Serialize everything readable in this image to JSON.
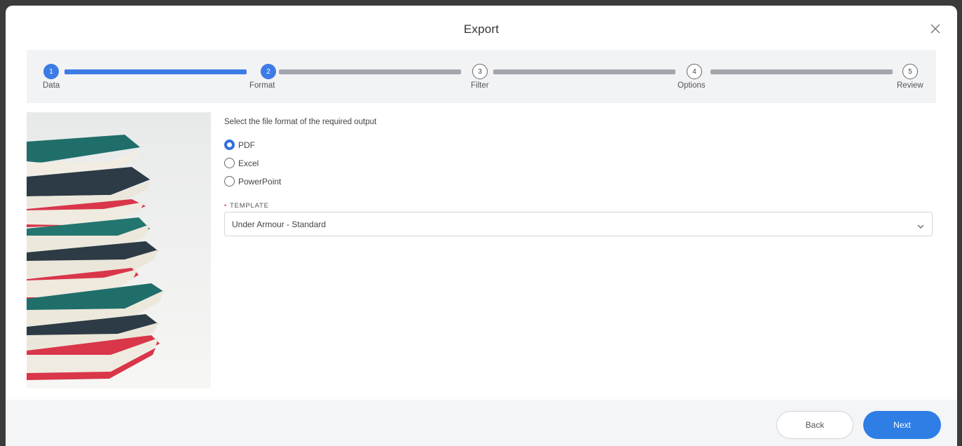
{
  "dialog": {
    "title": "Export",
    "close_icon": "close-icon"
  },
  "stepper": {
    "steps": [
      {
        "number": "1",
        "label": "Data",
        "state": "complete"
      },
      {
        "number": "2",
        "label": "Format",
        "state": "current"
      },
      {
        "number": "3",
        "label": "Filter",
        "state": "pending"
      },
      {
        "number": "4",
        "label": "Options",
        "state": "pending"
      },
      {
        "number": "5",
        "label": "Review",
        "state": "pending"
      }
    ]
  },
  "form": {
    "instruction": "Select the file format of the required output",
    "formats": [
      {
        "label": "PDF",
        "selected": true
      },
      {
        "label": "Excel",
        "selected": false
      },
      {
        "label": "PowerPoint",
        "selected": false
      }
    ],
    "template_label": "TEMPLATE",
    "template_required_marker": "•",
    "template_value": "Under Armour - Standard",
    "template_chevron_icon": "chevron-down-icon"
  },
  "footer": {
    "back_label": "Back",
    "next_label": "Next"
  },
  "colors": {
    "accent": "#3d7be6",
    "primary_button": "#2f7ee6",
    "required": "#e0424b"
  }
}
